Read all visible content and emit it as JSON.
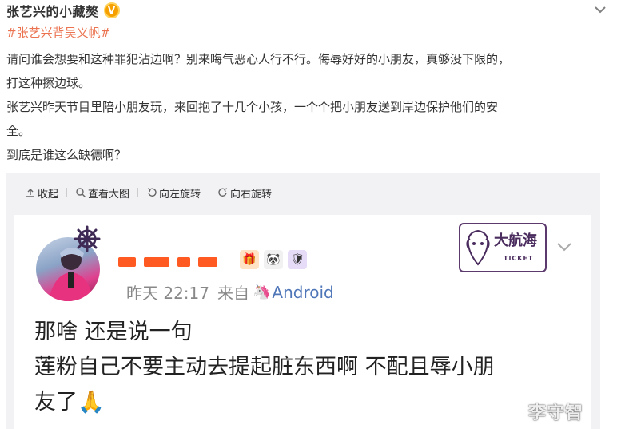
{
  "post": {
    "author": "张艺兴的小藏獒",
    "hashtag": "#张艺兴背吴义帆#",
    "lines": [
      "请问谁会想要和这种罪犯沾边啊？别来晦气恶心人行不行。侮辱好好的小朋友，真够没下限的，",
      "打这种擦边球。",
      "张艺兴昨天节目里陪小朋友玩，来回抱了十几个小孩，一个个把小朋友送到岸边保护他们的安",
      "全。",
      "到底是谁这么缺德啊？"
    ],
    "icons": {
      "verified": "verified-v-icon",
      "menu": "chevron-down-icon"
    }
  },
  "toolbar": {
    "collapse_label": "收起",
    "view_large_label": "查看大图",
    "rotate_left_label": "向左旋转",
    "rotate_right_label": "向右旋转"
  },
  "embedded": {
    "time": "昨天 22:17",
    "via": "来自",
    "client": "Android",
    "stamp_title": "大航海",
    "stamp_sub": "TICKET",
    "text_lines": [
      "那啥 还是说一句",
      "莲粉自己不要主动去提起脏东西啊 不配且辱小朋",
      "友了🙏"
    ],
    "badges": [
      "🎁",
      "🐼",
      "🛡"
    ]
  },
  "watermark": "李守智",
  "colors": {
    "hashtag": "#eb7350",
    "client_link": "#4f76b8",
    "redaction": "#ff5a22",
    "card_bg": "#f2f2f5"
  }
}
